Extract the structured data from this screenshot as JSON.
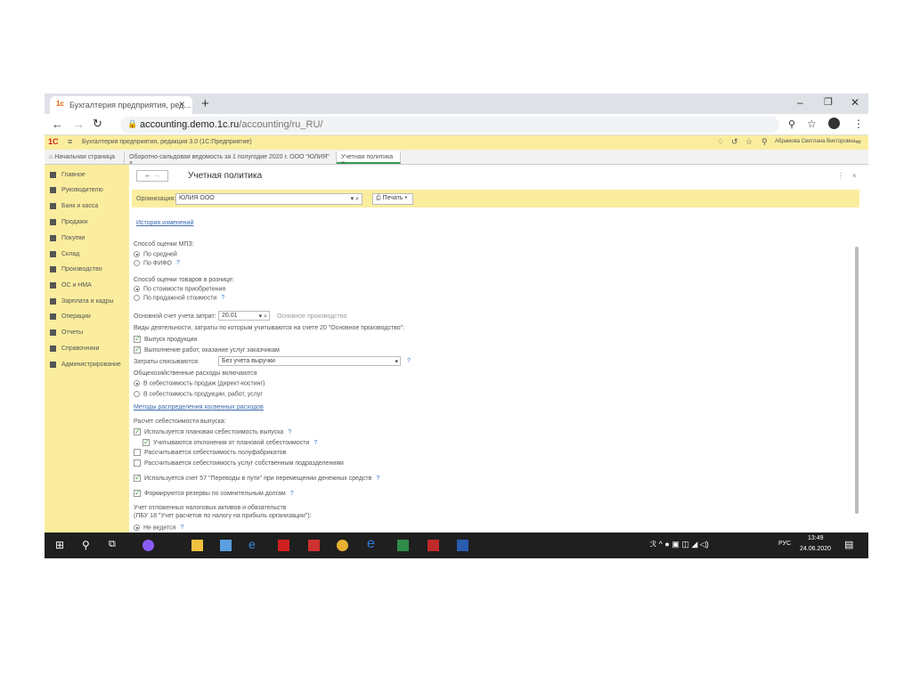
{
  "browser": {
    "tab_title": "Бухгалтерия предприятия, ред...",
    "url_host": "accounting.demo.1c.ru",
    "url_path": "/accounting/ru_RU/"
  },
  "app": {
    "logo": "1С",
    "title": "Бухгалтерия предприятия, редакция 3.0  (1С:Предприятие)",
    "user": "Абрамова Светлана Викторовна"
  },
  "open_tabs": [
    {
      "label": "Начальная страница"
    },
    {
      "label": "Оборотно-сальдовая ведомость за 1 полугодие 2020 г. ООО \"ЮЛИЯ\" ×"
    },
    {
      "label": "Учетная политика ×"
    }
  ],
  "sidebar": {
    "items": [
      {
        "label": "Главное"
      },
      {
        "label": "Руководителю"
      },
      {
        "label": "Банк и касса"
      },
      {
        "label": "Продажи"
      },
      {
        "label": "Покупки"
      },
      {
        "label": "Склад"
      },
      {
        "label": "Производство"
      },
      {
        "label": "ОС и НМА"
      },
      {
        "label": "Зарплата и кадры"
      },
      {
        "label": "Операции"
      },
      {
        "label": "Отчеты"
      },
      {
        "label": "Справочники"
      },
      {
        "label": "Администрирование"
      }
    ]
  },
  "form": {
    "title": "Учетная политика",
    "org_label": "Организация:",
    "org_value": "ЮЛИЯ ООО",
    "print_label": "Печать",
    "history_link": "История изменений",
    "mpz_label": "Способ оценки МПЗ:",
    "mpz_opt1": "По средней",
    "mpz_opt2": "По ФИФО",
    "retail_label": "Способ оценки товаров в рознице:",
    "retail_opt1": "По стоимости приобретения",
    "retail_opt2": "По продажной стоимости",
    "account_label": "Основной счет учета затрат:",
    "account_value": "20.01",
    "account_name": "Основное производство",
    "activities_label": "Виды деятельности, затраты по которым учитываются на счете 20 \"Основное производство\":",
    "act1": "Выпуск продукции",
    "act2": "Выполнение работ, оказание услуг заказчикам",
    "costs_label": "Затраты списываются:",
    "costs_value": "Без учета выручки",
    "overhead_label": "Общехозяйственные расходы включаются",
    "overhead_opt1": "В себестоимость продаж (директ-костинг)",
    "overhead_opt2": "В  себестоимость продукции, работ, услуг",
    "methods_link": "Методы распределения косвенных расходов",
    "calc_label": "Расчет себестоимости выпуска:",
    "calc1": "Используется плановая себестоимость выпуска",
    "calc2": "Учитываются отклонения от плановой себестоимости",
    "calc3": "Рассчитывается себестоимость полуфабрикатов",
    "calc4": "Рассчитывается себестоимость услуг собственным подразделениям",
    "acc57": "Используется счет 57 \"Переводы в пути\" при перемещении денежных средств",
    "reserves": "Формируются резервы по сомнительным долгам",
    "deferred_label1": "Учет отложенных налоговых активов и обязательств",
    "deferred_label2": "(ПБУ 18 \"Учет расчетов по налогу на прибыль организации\"):",
    "deferred_opt1": "Не ведется",
    "help": "?"
  },
  "taskbar": {
    "lang": "РУС",
    "time": "13:49",
    "date": "24.06.2020"
  }
}
